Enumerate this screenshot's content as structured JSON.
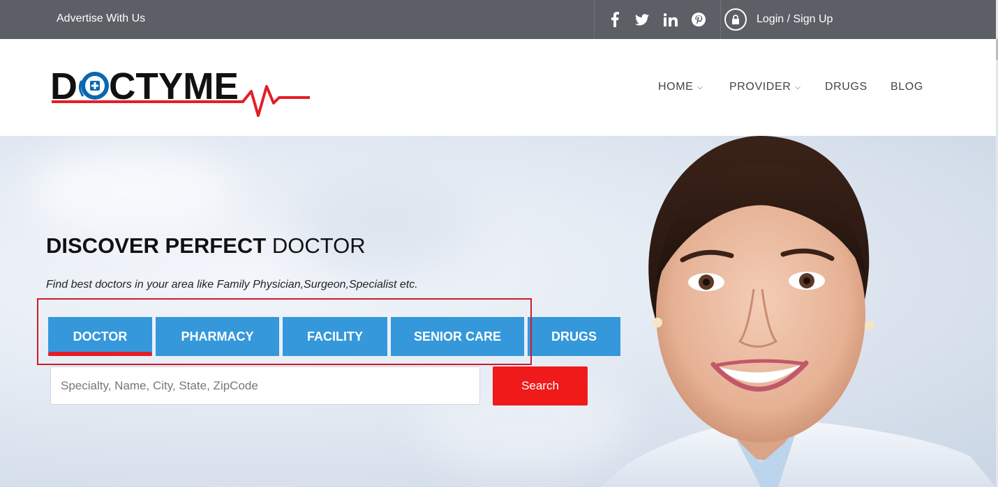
{
  "topbar": {
    "advertise_label": "Advertise With Us",
    "social_icons": [
      "facebook-icon",
      "twitter-icon",
      "linkedin-icon",
      "pinterest-icon"
    ],
    "social_glyphs": [
      "f",
      "t",
      "in",
      "p"
    ],
    "login_label": "Login / Sign Up",
    "background": "#5c5f66"
  },
  "header": {
    "logo_text": "DOCTYME",
    "nav": [
      {
        "label": "HOME",
        "has_dropdown": true
      },
      {
        "label": "PROVIDER",
        "has_dropdown": true
      },
      {
        "label": "DRUGS",
        "has_dropdown": false
      },
      {
        "label": "BLOG",
        "has_dropdown": false
      }
    ]
  },
  "hero": {
    "title_bold": "DISCOVER PERFECT",
    "title_light": "DOCTOR",
    "subtitle": "Find best doctors in your area like Family Physician,Surgeon,Specialist etc.",
    "tabs": [
      {
        "label": "DOCTOR",
        "active": true
      },
      {
        "label": "PHARMACY",
        "active": false
      },
      {
        "label": "FACILITY",
        "active": false
      },
      {
        "label": "SENIOR CARE",
        "active": false
      },
      {
        "label": "DRUGS",
        "active": false
      }
    ],
    "search": {
      "placeholder": "Specialty, Name, City, State, ZipCode",
      "value": "",
      "button_label": "Search"
    }
  },
  "colors": {
    "tab_blue": "#3498db",
    "accent_red": "#f01a1a",
    "active_underline": "#e41e26",
    "highlight_border": "#d11a2a"
  }
}
